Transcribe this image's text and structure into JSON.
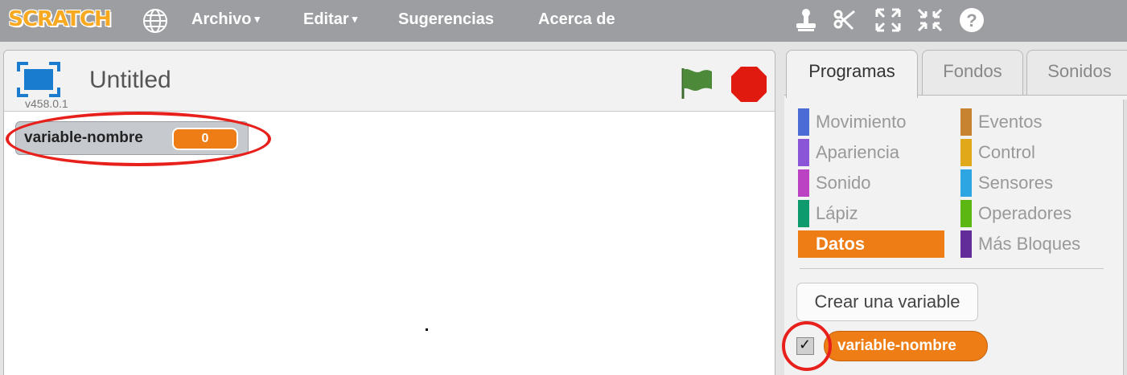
{
  "menubar": {
    "logo": "SCRATCH",
    "items": [
      {
        "label": "Archivo",
        "has_caret": true
      },
      {
        "label": "Editar",
        "has_caret": true
      },
      {
        "label": "Sugerencias",
        "has_caret": false
      },
      {
        "label": "Acerca de",
        "has_caret": false
      }
    ],
    "caret": "▾",
    "icons": [
      "globe-icon",
      "duplicate-stamp-icon",
      "cut-scissors-icon",
      "grow-icon",
      "shrink-icon",
      "help-icon"
    ],
    "help_glyph": "?"
  },
  "stage": {
    "title": "Untitled",
    "version": "v458.0.1",
    "monitor": {
      "name": "variable-nombre",
      "value": "0"
    },
    "colors": {
      "flag": "#4c8a3a",
      "stop": "#e01a0e",
      "fullscreen": "#1a7ccf"
    }
  },
  "tabs": [
    "Programas",
    "Fondos",
    "Sonidos"
  ],
  "categories": {
    "left": [
      {
        "label": "Movimiento",
        "color": "#4a6cd4"
      },
      {
        "label": "Apariencia",
        "color": "#8a55d7"
      },
      {
        "label": "Sonido",
        "color": "#bb42c3"
      },
      {
        "label": "Lápiz",
        "color": "#0e9a6c"
      },
      {
        "label": "Datos",
        "color": "#ee7d16",
        "selected": true
      }
    ],
    "right": [
      {
        "label": "Eventos",
        "color": "#c88330"
      },
      {
        "label": "Control",
        "color": "#e1a91a"
      },
      {
        "label": "Sensores",
        "color": "#2ca5e2"
      },
      {
        "label": "Operadores",
        "color": "#5cb712"
      },
      {
        "label": "Más Bloques",
        "color": "#632d99"
      }
    ]
  },
  "palette": {
    "make_variable_label": "Crear una variable",
    "variable_reporter": "variable-nombre",
    "checkbox_checked": true,
    "check_glyph": "✓"
  },
  "annotations": {
    "color": "#e8201b"
  }
}
